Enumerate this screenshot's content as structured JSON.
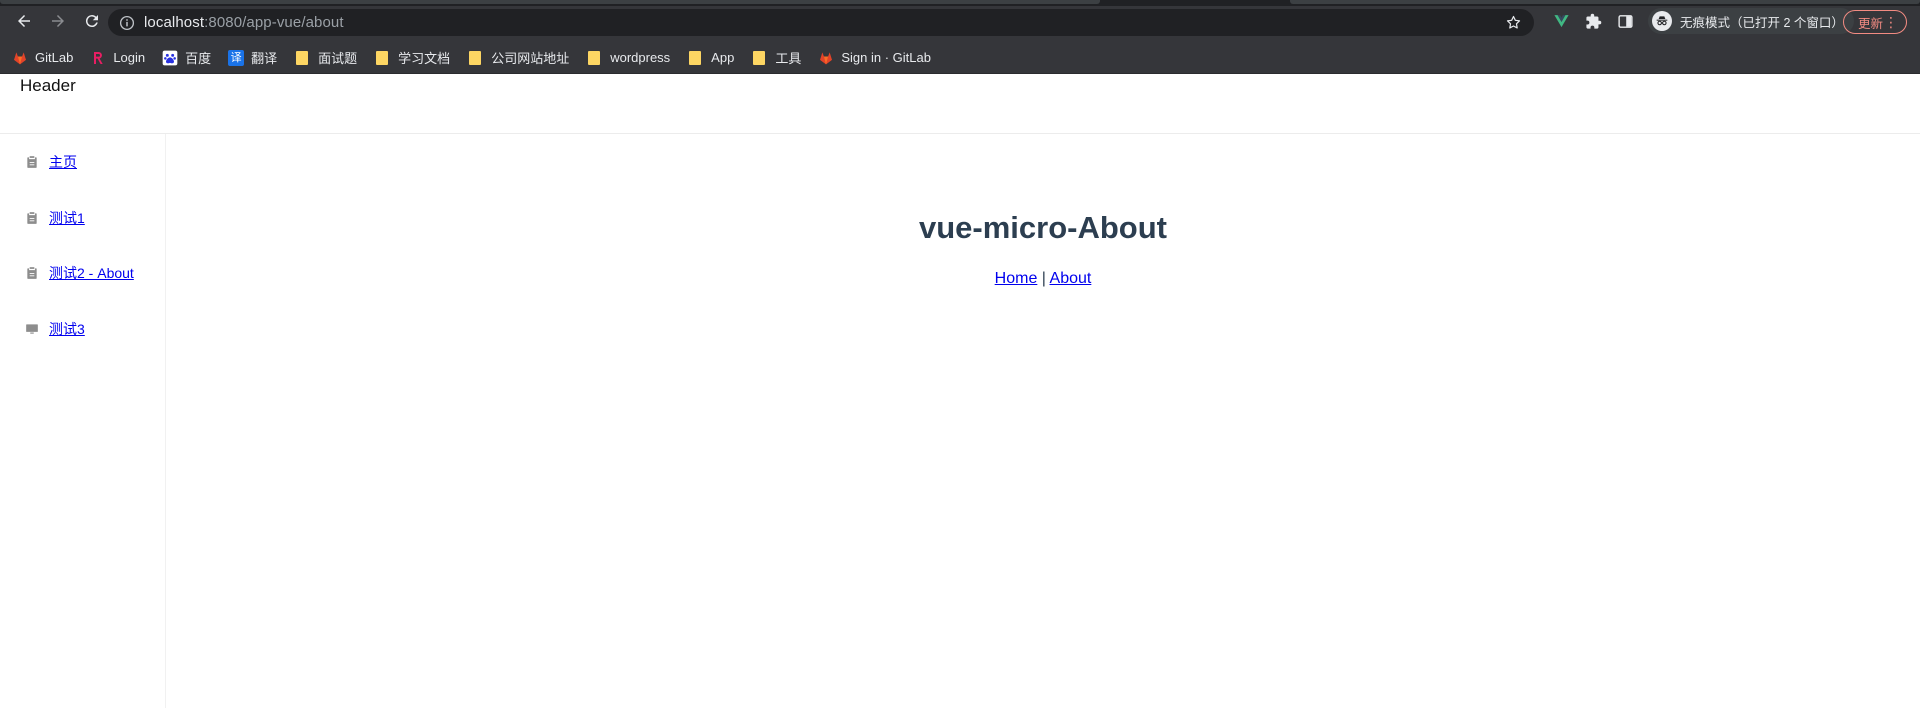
{
  "browser": {
    "url_host": "localhost",
    "url_rest": ":8080/app-vue/about",
    "incognito_label": "无痕模式（已打开 2 个窗口）",
    "update_label": "更新",
    "menu_glyph": "⋮"
  },
  "bookmarks": [
    {
      "label": "GitLab",
      "icon": "gitlab-icon"
    },
    {
      "label": "Login",
      "icon": "login-r-icon"
    },
    {
      "label": "百度",
      "icon": "baidu-icon"
    },
    {
      "label": "翻译",
      "icon": "translate-icon"
    },
    {
      "label": "面试题",
      "icon": "folder-icon"
    },
    {
      "label": "学习文档",
      "icon": "folder-icon"
    },
    {
      "label": "公司网站地址",
      "icon": "folder-icon"
    },
    {
      "label": "wordpress",
      "icon": "folder-icon"
    },
    {
      "label": "App",
      "icon": "folder-icon"
    },
    {
      "label": "工具",
      "icon": "folder-icon"
    },
    {
      "label": "Sign in · GitLab",
      "icon": "gitlab-icon"
    }
  ],
  "translate_glyph": "译",
  "app": {
    "header": "Header",
    "menu": [
      {
        "label": " 主页",
        "icon": "clipboard-icon"
      },
      {
        "label": "测试1",
        "icon": "clipboard-icon"
      },
      {
        "label": "测试2 - About",
        "icon": "clipboard-icon"
      },
      {
        "label": "测试3",
        "icon": "monitor-icon"
      }
    ],
    "title": "vue-micro-About",
    "nav": {
      "home": "Home",
      "separator": " | ",
      "about": "About"
    }
  },
  "colors": {
    "chrome_bg": "#35363a",
    "omnibox_bg": "#202124",
    "title_color": "#2c3e50",
    "link_color": "#0000ee",
    "update_accent": "#f28b82",
    "folder_yellow": "#fdd663"
  }
}
